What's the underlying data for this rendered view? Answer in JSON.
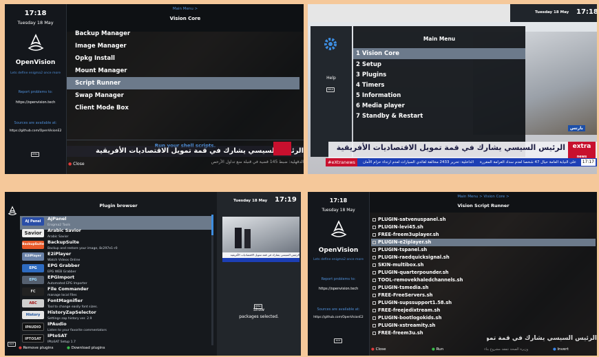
{
  "ov_common": {
    "time": "17:18",
    "date": "Tuesday 18 May",
    "brand": "OpenVision",
    "tagline": "Lets define enigma2 once more",
    "report_label": "Report problems to:",
    "report_url": "https://openvision.tech",
    "sources_label": "Sources are available at:",
    "sources_url": "https://github.com/OpenVisionE2",
    "menu_key": "MENU",
    "exit_key": "EXIT"
  },
  "p1": {
    "breadcrumb": "Main Menu >",
    "title": "Vision Core",
    "items": [
      "Backup Manager",
      "Image Manager",
      "Opkg Install",
      "Mount Manager",
      "Script Runner",
      "Swap Manager",
      "Client Mode Box"
    ],
    "selected_index": 4,
    "hint": "Run your shell scripts.",
    "close": "Close",
    "ticker_top": "الرئيس السيسي يشارك في قمة تمويل الاقتصاديات الأفريقية",
    "ticker_bottom": "الدقهلية: ضبط 145 قضية في قنبلة منع تداول الأرحص"
  },
  "p2": {
    "date": "Tuesday 18 May",
    "time": "17:18",
    "title": "Main Menu",
    "items": [
      "1 Vision Core",
      "2 Setup",
      "3 Plugins",
      "4 Timers",
      "5 Information",
      "6 Media player",
      "7 Standby & Restart"
    ],
    "selected_index": 0,
    "help": "Help",
    "help_key": "HELP",
    "news_tag": "#eXtranews",
    "news_brand": "extra",
    "news_brand2": "news",
    "news_headline": "الرئيس السيسي يشارك في قمة تمويل الاقتصاديات الأفريقية",
    "news_small": "بارتس",
    "ticker": "الداخلية: تحرير 2433 مخالفة لقائدي السيارات لعدم ارتداء حزام الأمان",
    "ticker2": "على النيابة العامة حيال 47 شخصا لعدم سداد الغرامة المقررة",
    "clock_small": "17:17"
  },
  "p3": {
    "title": "Plugin browser",
    "date": "Tuesday 18 May",
    "time": "17:19",
    "plugins": [
      {
        "logo": "AJ Panel",
        "name": "AjPanel",
        "desc": "Enigma2 Tools"
      },
      {
        "logo": "Savior",
        "name": "Arabic Savior",
        "desc": "Arabic Savior"
      },
      {
        "logo": "BackupSuite",
        "name": "BackupSuite",
        "desc": "Backup and restore your image, 8c297e1-r0"
      },
      {
        "logo": "E2iPlayer",
        "name": "E2iPlayer",
        "desc": "Watch Videos Online"
      },
      {
        "logo": "EPG",
        "name": "EPG Grabber",
        "desc": "EPG WEB Grabber"
      },
      {
        "logo": "EPG",
        "name": "EPGImport",
        "desc": "Automated EPG Importer"
      },
      {
        "logo": "FC",
        "name": "File Commander",
        "desc": "manage local Files"
      },
      {
        "logo": "ABC",
        "name": "FontMagnifier",
        "desc": "Tool to change easily font sizes."
      },
      {
        "logo": "History",
        "name": "HistoryZapSelector",
        "desc": "Settings zap history ver. 2.9"
      },
      {
        "logo": "IPAUDIO",
        "name": "IPAudio",
        "desc": "Listen to your favorite commentators"
      },
      {
        "logo": "IPTOSAT",
        "name": "IPtoSAT",
        "desc": "IPtoSAT Setup 1.7"
      }
    ],
    "selected_index": 0,
    "menu_key": "MENU",
    "show_line1": "Show",
    "show_line2": "packages selected.",
    "remove": "Remove plugins",
    "download": "Download plugins",
    "exit_key": "EXIT",
    "preview_text": "الرئيس السيسي يشارك في قمة تمويل الاقتصاديات الأفريقية"
  },
  "p4": {
    "breadcrumb": "Main Menu > Vision Core >",
    "title": "Vision Script Runner",
    "scripts": [
      "PLUGIN-satvenuspanel.sh",
      "PLUGIN-levi45.sh",
      "FREE-freem3uplayer.sh",
      "PLUGIN-e2iplayer.sh",
      "PLUGIN-tspanel.sh",
      "PLUGIN-raedquicksignal.sh",
      "SKIN-multibox.sh",
      "PLUGIN-quarterpounder.sh",
      "TOOL-removekhaledchannels.sh",
      "PLUGIN-tsmedia.sh",
      "FREE-FreeServers.sh",
      "PLUGIN-supssupport1.58.sh",
      "FREE-freejedixtream.sh",
      "PLUGIN-bootlogokids.sh",
      "PLUGIN-xstreamity.sh",
      "FREE-freem3u.sh"
    ],
    "selected_index": 3,
    "close": "Close",
    "run": "Run",
    "invert": "Invert",
    "ticker": "الرئيس السيسي يشارك في قمة تمويل الاقتصاديات",
    "ticker_small": "وزيرة الصحة تتفقد مشروع بناء"
  },
  "colors": {
    "accent": "#4f8fd9",
    "selected": "#6c7a8b",
    "red": "#e23b3b",
    "green": "#38c04b",
    "blue": "#3a85e8"
  }
}
